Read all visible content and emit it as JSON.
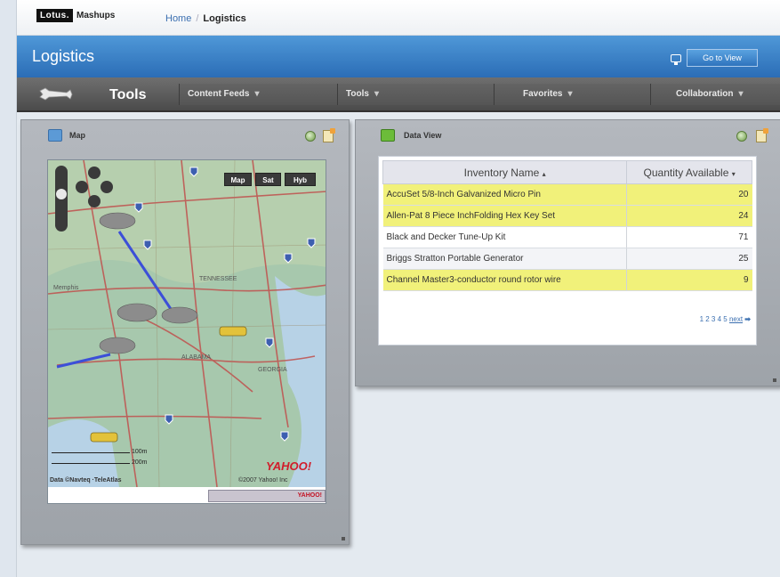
{
  "topbar": {
    "logo_mark": "Lotus.",
    "logo_text": "Mashups",
    "breadcrumb_home": "Home",
    "breadcrumb_sep": "/",
    "breadcrumb_current": "Logistics"
  },
  "titlebar": {
    "title": "Logistics",
    "goto_label": "Go to View",
    "accent": "#3a80c8"
  },
  "toolbar": {
    "title": "Tools",
    "menus": [
      {
        "label": "Content Feeds",
        "caret": "▾"
      },
      {
        "label": "Tools",
        "caret": "▾"
      },
      {
        "label": "Favorites",
        "caret": "▾"
      },
      {
        "label": "Collaboration",
        "caret": "▾"
      }
    ]
  },
  "map_panel": {
    "title": "Map",
    "map_type_buttons": [
      "Map",
      "Sat",
      "Hyb"
    ],
    "city_labels": [
      "Memphis",
      "TENNESSEE",
      "ALABAMA",
      "GEORGIA"
    ],
    "scale_miles": "100m",
    "scale_km": "200m",
    "credit": "Data ©Navteq ·TeleAtlas",
    "copyright": "©2007 Yahoo! Inc",
    "brand": "YAHOO!"
  },
  "data_panel": {
    "title": "Data View",
    "columns": [
      {
        "label": "Inventory Name",
        "sort": "▴"
      },
      {
        "label": "Quantity Available",
        "sort": "▾"
      }
    ],
    "rows": [
      {
        "name": "AccuSet 5/8-Inch Galvanized Micro Pin",
        "qty": "20",
        "highlight": true
      },
      {
        "name": "Allen-Pat 8 Piece InchFolding Hex Key Set",
        "qty": "24",
        "highlight": true
      },
      {
        "name": "Black and Decker Tune-Up Kit",
        "qty": "71",
        "highlight": false
      },
      {
        "name": "Briggs Stratton Portable Generator",
        "qty": "25",
        "highlight": false
      },
      {
        "name": "Channel Master3-conductor round rotor wire",
        "qty": "9",
        "highlight": true
      }
    ],
    "pager_pages": "1 2 3 4 5",
    "pager_next": "next",
    "highlight_color": "#f1f17a"
  }
}
